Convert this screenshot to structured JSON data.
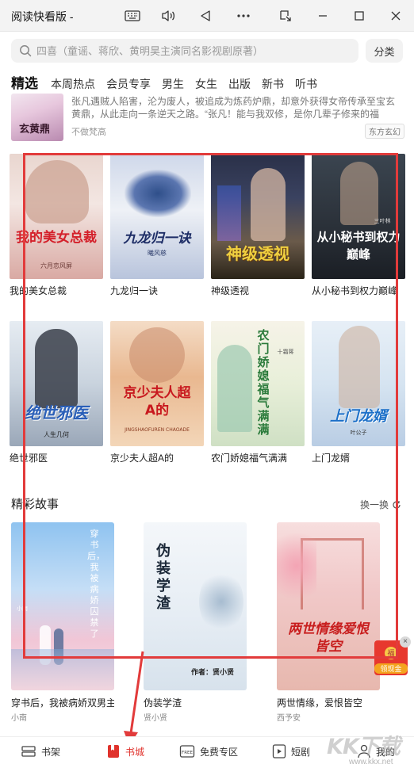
{
  "window": {
    "title": "阅读快看版 -",
    "controls": [
      "keyboard-icon",
      "volume-icon",
      "back-icon",
      "more-icon",
      "screen-icon",
      "minimize-icon",
      "maximize-icon",
      "close-icon"
    ]
  },
  "search": {
    "placeholder": "四喜（童谣、蒋欣、黄明昊主演同名影视剧原著）",
    "category_label": "分类"
  },
  "tabs": [
    {
      "label": "精选",
      "active": true
    },
    {
      "label": "本周热点",
      "active": false
    },
    {
      "label": "会员专享",
      "active": false
    },
    {
      "label": "男生",
      "active": false
    },
    {
      "label": "女生",
      "active": false
    },
    {
      "label": "出版",
      "active": false
    },
    {
      "label": "新书",
      "active": false
    },
    {
      "label": "听书",
      "active": false
    }
  ],
  "featured": {
    "cover_title": "玄黄鼎",
    "description": "张凡遇贼人陷害，沦为废人，被追成为炼药炉鼎，却意外获得女帝传承至宝玄黄鼎，从此走向一条逆天之路。“张凡！能与我双修，是你几辈子修来的福分！”初逼女帝、戏谑不屑，...",
    "author": "不做梵高",
    "tag": "东方玄幻"
  },
  "books": [
    {
      "title": "我的美女总裁",
      "cover_text": "我的美女总裁",
      "cover_sub": "六月恋风屏"
    },
    {
      "title": "九龙归一诀",
      "cover_text": "九龙归一诀",
      "cover_sub": "曦风慈"
    },
    {
      "title": "神级透视",
      "cover_text": "神级透视",
      "cover_sub": ""
    },
    {
      "title": "从小秘书到权力巅峰",
      "cover_text": "从小秘书到权力巅峰",
      "cover_sub": "三叶林"
    },
    {
      "title": "绝世邪医",
      "cover_text": "绝世邪医",
      "cover_sub": "人生几何"
    },
    {
      "title": "京少夫人超A的",
      "cover_text": "京少夫人超A的",
      "cover_sub": "JINGSHAOFUREN CHAOADE"
    },
    {
      "title": "农门娇媳福气满满",
      "cover_text": "农门娇媳福气满满",
      "cover_sub": "十霜蒋"
    },
    {
      "title": "上门龙婿",
      "cover_text": "上门龙婿",
      "cover_sub": "叶公子"
    }
  ],
  "section": {
    "title": "精彩故事",
    "refresh_label": "换一换"
  },
  "stories": [
    {
      "title": "穿书后，我被病娇双男主囚...",
      "author": "小南",
      "cover_text": "穿书后，我被病娇囚禁了",
      "cover_sub": "小南"
    },
    {
      "title": "伪装学渣",
      "author": "贤小贤",
      "cover_text": "伪装学渣",
      "cover_sub": "作者：贤小贤"
    },
    {
      "title": "两世情缘，爱恨皆空",
      "author": "西予安",
      "cover_text": "两世情缘爱恨皆空",
      "cover_sub": ""
    }
  ],
  "red_packet": {
    "coin": "福",
    "label": "领现金"
  },
  "nav": [
    {
      "label": "书架",
      "active": false
    },
    {
      "label": "书城",
      "active": true
    },
    {
      "label": "免费专区",
      "active": false
    },
    {
      "label": "短剧",
      "active": false
    },
    {
      "label": "我的",
      "active": false
    }
  ],
  "watermark": {
    "text": "KK下载",
    "url": "www.kkx.net"
  },
  "colors": {
    "accent": "#e0322c",
    "annotation": "#e23b3b"
  }
}
